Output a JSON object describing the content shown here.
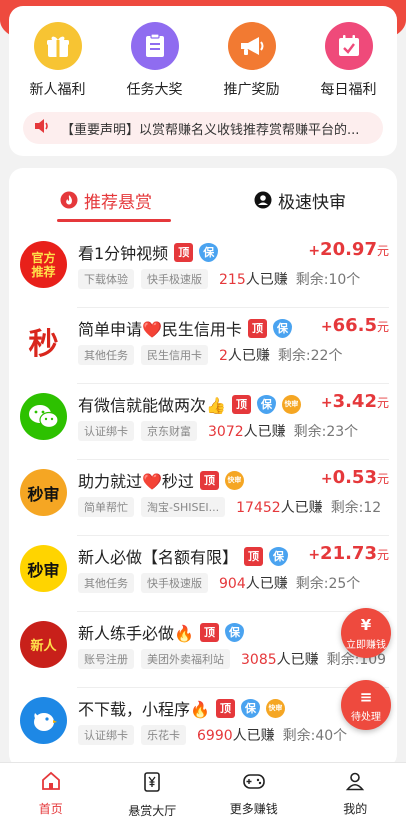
{
  "shortcuts": [
    {
      "label": "新人福利",
      "icon": "gift-icon",
      "color": "#f7c433"
    },
    {
      "label": "任务大奖",
      "icon": "task-list-icon",
      "color": "#8f6cf0"
    },
    {
      "label": "推广奖励",
      "icon": "megaphone-icon",
      "color": "#f27a32"
    },
    {
      "label": "每日福利",
      "icon": "calendar-check-icon",
      "color": "#ef4a7a"
    }
  ],
  "notice": {
    "text": "【重要声明】以赏帮赚名义收钱推荐赏帮赚平台的..."
  },
  "tabs": [
    {
      "label": "推荐悬赏",
      "active": true
    },
    {
      "label": "极速快审",
      "active": false
    }
  ],
  "tasks": [
    {
      "avatar_text": "官方\n推荐",
      "title": "看1分钟视频",
      "badges": [
        "顶",
        "保"
      ],
      "tags": [
        "下载体验",
        "快手极速版"
      ],
      "earned": "215",
      "earned_suffix": "人已赚",
      "remain": "剩余:10个",
      "sign": "+",
      "amount": "20.97",
      "unit": "元"
    },
    {
      "avatar_text": "秒",
      "title": "简单申请❤️民生信用卡",
      "badges": [
        "顶",
        "保"
      ],
      "tags": [
        "其他任务",
        "民生信用卡"
      ],
      "earned": "2",
      "earned_suffix": "人已赚",
      "remain": "剩余:22个",
      "sign": "+",
      "amount": "66.5",
      "unit": "元"
    },
    {
      "avatar_text": "",
      "title": "有微信就能做两次👍",
      "badges": [
        "顶",
        "保",
        "快审"
      ],
      "tags": [
        "认证绑卡",
        "京东财富"
      ],
      "earned": "3072",
      "earned_suffix": "人已赚",
      "remain": "剩余:23个",
      "sign": "+",
      "amount": "3.42",
      "unit": "元"
    },
    {
      "avatar_text": "秒审",
      "title": "助力就过❤️秒过",
      "badges": [
        "顶",
        "快审"
      ],
      "tags": [
        "简单帮忙",
        "淘宝-SHISEI..."
      ],
      "earned": "17452",
      "earned_suffix": "人已赚",
      "remain": "剩余:12",
      "sign": "+",
      "amount": "0.53",
      "unit": "元"
    },
    {
      "avatar_text": "秒审",
      "title": "新人必做【名额有限】",
      "badges": [
        "顶",
        "保"
      ],
      "tags": [
        "其他任务",
        "快手极速版"
      ],
      "earned": "904",
      "earned_suffix": "人已赚",
      "remain": "剩余:25个",
      "sign": "+",
      "amount": "21.73",
      "unit": "元"
    },
    {
      "avatar_text": "新人",
      "title": "新人练手必做🔥",
      "badges": [
        "顶",
        "保"
      ],
      "tags": [
        "账号注册",
        "美团外卖福利站"
      ],
      "earned": "3085",
      "earned_suffix": "人已赚",
      "remain": "剩余:109",
      "sign": "+",
      "amount": "",
      "unit": ""
    },
    {
      "avatar_text": "",
      "title": "不下载，小程序🔥",
      "badges": [
        "顶",
        "保",
        "快审"
      ],
      "tags": [
        "认证绑卡",
        "乐花卡"
      ],
      "earned": "6990",
      "earned_suffix": "人已赚",
      "remain": "剩余:40个",
      "sign": "+",
      "amount": "",
      "unit": ""
    }
  ],
  "floating": [
    {
      "label": "立即赚钱",
      "glyph": "¥"
    },
    {
      "label": "待处理",
      "glyph": "≡"
    }
  ],
  "nav": [
    {
      "label": "首页",
      "active": true
    },
    {
      "label": "悬赏大厅",
      "active": false
    },
    {
      "label": "更多赚钱",
      "active": false
    },
    {
      "label": "我的",
      "active": false
    }
  ],
  "colors": {
    "accent": "#e5383b",
    "top_bar": "#ee4a3e"
  }
}
